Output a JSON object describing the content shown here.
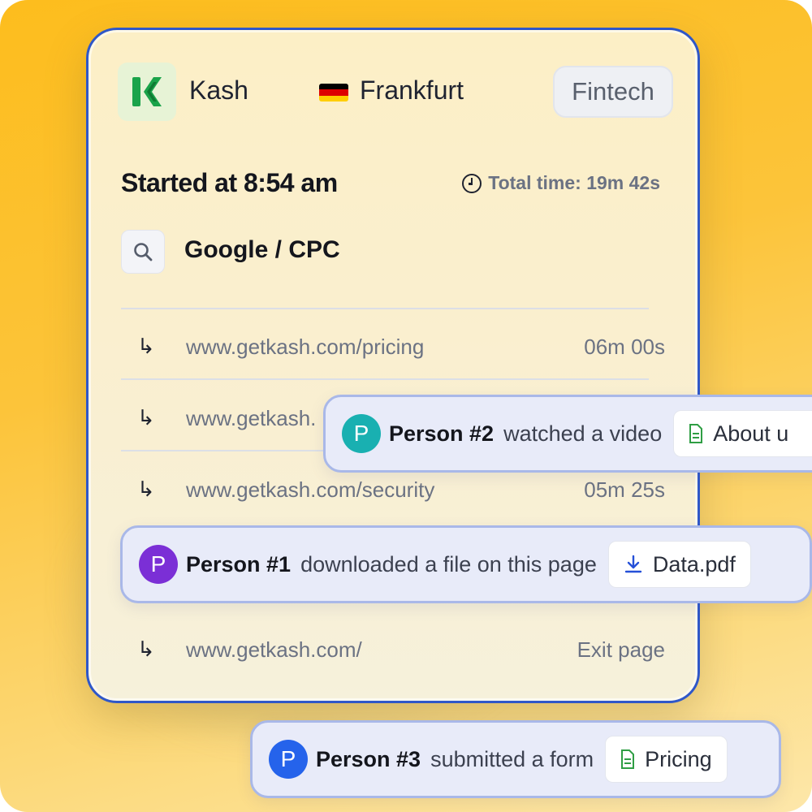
{
  "company": {
    "name": "Kash",
    "city": "Frankfurt",
    "industry": "Fintech"
  },
  "session": {
    "started": "Started at 8:54 am",
    "total_time": "Total time: 19m 42s",
    "source": "Google / CPC"
  },
  "visits": [
    {
      "url": "www.getkash.com/pricing",
      "duration": "06m 00s"
    },
    {
      "url": "www.getkash.",
      "duration": ""
    },
    {
      "url": "www.getkash.com/security",
      "duration": "05m 25s"
    },
    {
      "url": "www.getkash.com/",
      "duration": "Exit page"
    }
  ],
  "arrow_glyph": "↳",
  "events": [
    {
      "avatar": "P",
      "person": "Person #2",
      "action": "watched a video",
      "chip": "About u",
      "chip_icon": "document-icon",
      "avatar_color": "#19b0b1"
    },
    {
      "avatar": "P",
      "person": "Person #1",
      "action": "downloaded a file on this page",
      "chip": "Data.pdf",
      "chip_icon": "download-icon",
      "avatar_color": "#7b2fd6"
    },
    {
      "avatar": "P",
      "person": "Person #3",
      "action": "submitted a form",
      "chip": "Pricing",
      "chip_icon": "document-icon",
      "avatar_color": "#2563eb"
    }
  ],
  "colors": {
    "card_border": "#2f57c8",
    "brand_green": "#1aa34a",
    "flag": [
      "#000000",
      "#dd0000",
      "#ffce00"
    ]
  }
}
